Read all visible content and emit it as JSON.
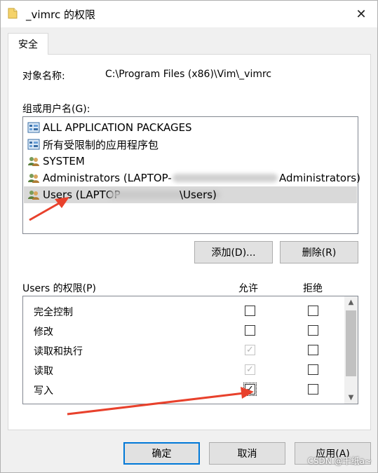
{
  "window": {
    "title": "_vimrc 的权限",
    "close_symbol": "✕"
  },
  "tab": {
    "label": "安全"
  },
  "object": {
    "label": "对象名称:",
    "value": "C:\\Program Files (x86)\\Vim\\_vimrc"
  },
  "groups": {
    "label": "组或用户名(G):",
    "items": [
      {
        "label": "ALL APPLICATION PACKAGES",
        "icon": "package-icon"
      },
      {
        "label": "所有受限制的应用程序包",
        "icon": "package-icon"
      },
      {
        "label": "SYSTEM",
        "icon": "users-icon"
      },
      {
        "label": "Administrators (LAPTOP-",
        "suffix": "Administrators)",
        "icon": "users-icon"
      },
      {
        "label": "Users (LAPTOP",
        "suffix": "\\Users)",
        "icon": "users-icon",
        "selected": true
      }
    ]
  },
  "buttons": {
    "add": "添加(D)...",
    "remove": "删除(R)"
  },
  "permissions": {
    "header": "Users 的权限(P)",
    "allow_header": "允许",
    "deny_header": "拒绝",
    "rows": [
      {
        "name": "完全控制",
        "allow": false,
        "allow_disabled": false,
        "deny": false
      },
      {
        "name": "修改",
        "allow": false,
        "allow_disabled": false,
        "deny": false
      },
      {
        "name": "读取和执行",
        "allow": true,
        "allow_disabled": true,
        "deny": false
      },
      {
        "name": "读取",
        "allow": true,
        "allow_disabled": true,
        "deny": false
      },
      {
        "name": "写入",
        "allow": true,
        "allow_disabled": false,
        "deny": false
      }
    ]
  },
  "footer": {
    "ok": "确定",
    "cancel": "取消",
    "apply": "应用(A)"
  },
  "watermark": "CSDN @千纸a~",
  "colors": {
    "annotation_arrow": "#e8412c",
    "focus_border": "#0078d7",
    "selection": "#d9d9d9"
  }
}
